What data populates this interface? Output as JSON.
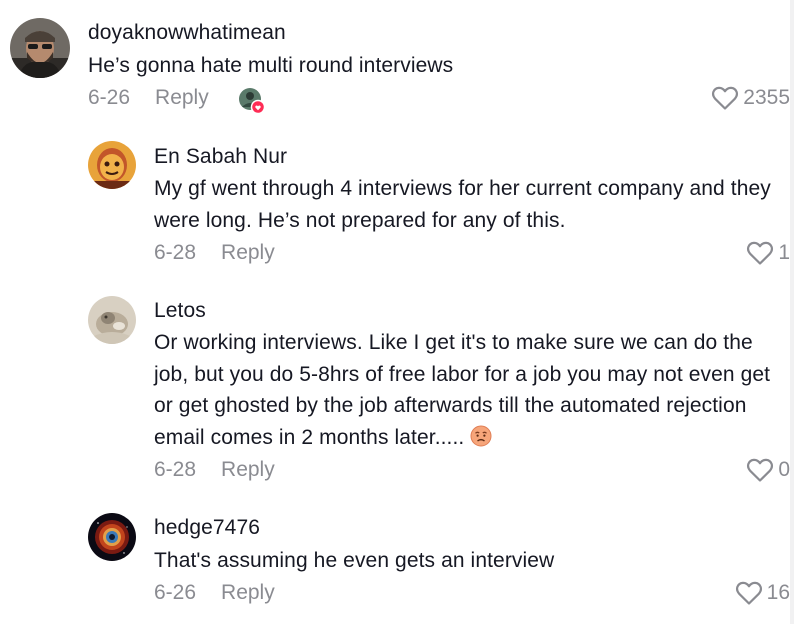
{
  "comments": [
    {
      "username": "doyaknowwhatimean",
      "text": "He’s gonna hate multi round interviews",
      "date": "6-26",
      "reply_label": "Reply",
      "likes": "2355",
      "avatar_icon": "bearded-man-avatar",
      "creator_liked": true
    },
    {
      "username": "En Sabah Nur",
      "text": "My gf went through 4 interviews for her current company and they were long. He’s not prepared for any of this.",
      "date": "6-28",
      "reply_label": "Reply",
      "likes": "1",
      "avatar_icon": "cartoon-face-avatar"
    },
    {
      "username": "Letos",
      "text": "Or working interviews. Like I get it's to make sure we can do the job, but you do 5-8hrs of free labor for a job you may not even get or get ghosted by the job afterwards till the automated rejection email comes in 2 months later.....",
      "emoji_icon": "worried-face-emoji",
      "date": "6-28",
      "reply_label": "Reply",
      "likes": "0",
      "avatar_icon": "animal-photo-avatar"
    },
    {
      "username": "hedge7476",
      "text": "That's assuming he even gets an interview",
      "date": "6-26",
      "reply_label": "Reply",
      "likes": "16",
      "avatar_icon": "nebula-eye-avatar"
    }
  ],
  "colors": {
    "text": "#161823",
    "secondary": "#8a8b91",
    "heart_badge": "#fe2c55"
  }
}
